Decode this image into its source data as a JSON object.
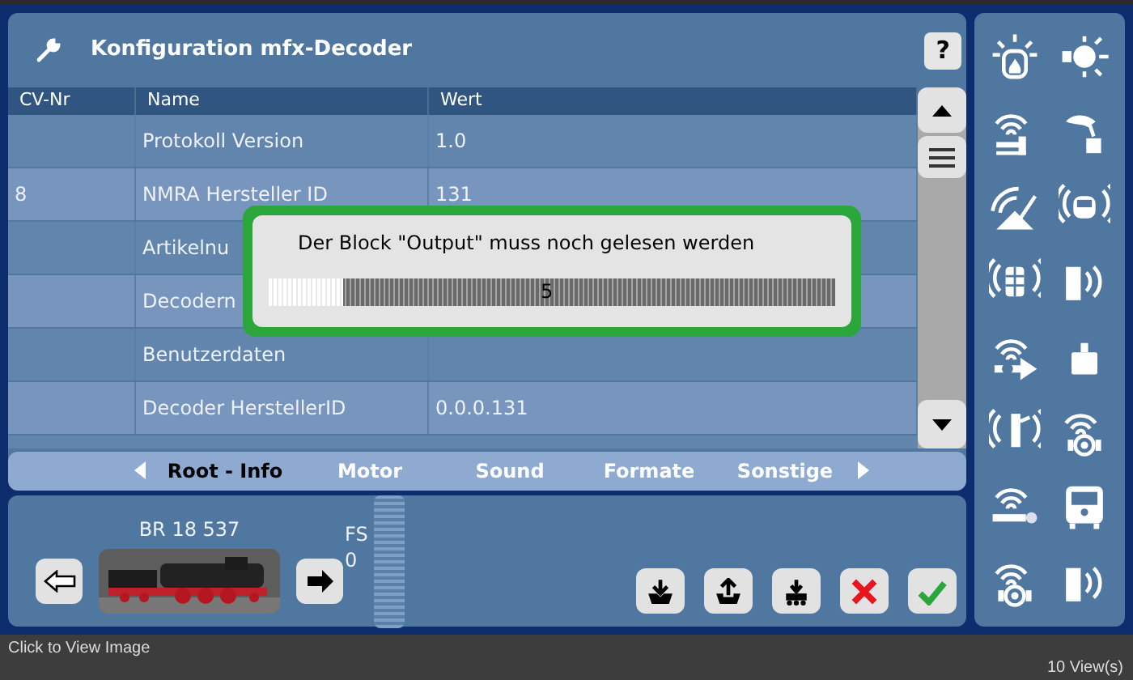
{
  "window": {
    "title": "Konfiguration mfx-Decoder",
    "help": "?"
  },
  "table": {
    "columns": [
      "CV-Nr",
      "Name",
      "Wert"
    ],
    "rows": [
      {
        "name": "Protokoll Version",
        "value": "1.0"
      },
      {
        "cv_nr": "8",
        "name": "NMRA Hersteller ID",
        "value": "131"
      },
      {
        "name": "Artikelnu"
      },
      {
        "name": "Decodern"
      },
      {
        "name": "Benutzerdaten"
      },
      {
        "name": "Decoder HerstellerID",
        "value": "0.0.0.131"
      }
    ]
  },
  "tabs": [
    {
      "label": "Root - Info",
      "selected": true
    },
    {
      "label": "Motor",
      "selected": false
    },
    {
      "label": "Sound",
      "selected": false
    },
    {
      "label": "Formate",
      "selected": false
    },
    {
      "label": "Sonstige",
      "selected": false
    }
  ],
  "dialog": {
    "message": "Der Block \"Output\" muss noch gelesen werden",
    "progress": {
      "level": 0.13,
      "label": "5"
    }
  },
  "locomotive": {
    "name": "BR 18 537",
    "speed_label": "FS",
    "speed": "0",
    "speed_slider": {
      "level": 0
    }
  },
  "footer": {
    "caption": "Click to View Image",
    "views": "10 View(s)"
  }
}
